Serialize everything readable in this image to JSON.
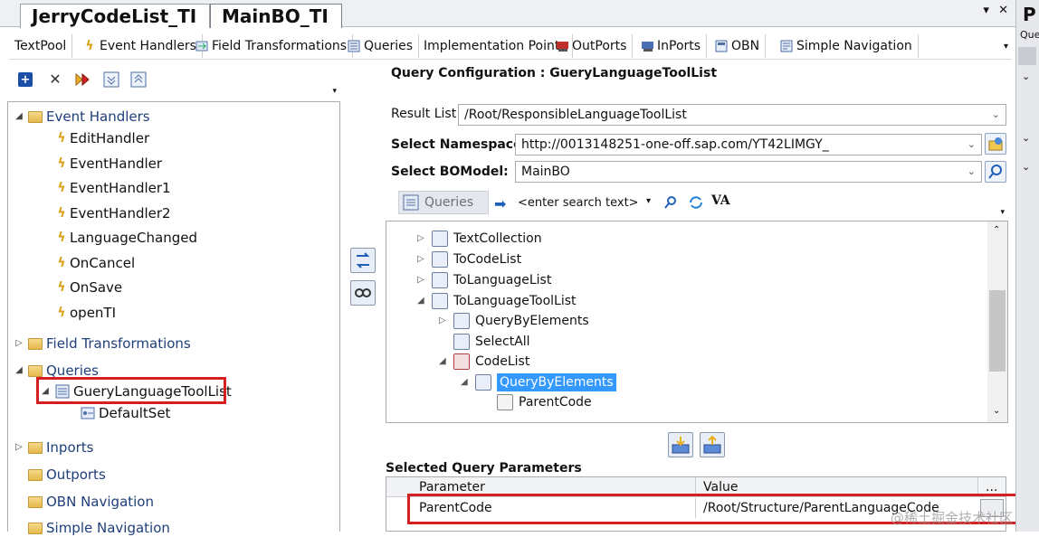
{
  "document_tabs": [
    {
      "label": "JerryCodeList_TI",
      "active": false
    },
    {
      "label": "MainBO_TI",
      "active": true
    }
  ],
  "window_controls": {
    "dropdown": "▾",
    "close": "✕"
  },
  "editor_tabs": [
    {
      "label": "TextPool",
      "icon": "none"
    },
    {
      "label": "Event Handlers",
      "icon": "lightning-icon"
    },
    {
      "label": "Field Transformations",
      "icon": "transform-icon"
    },
    {
      "label": "Queries",
      "icon": "query-icon"
    },
    {
      "label": "Implementation Points",
      "icon": "none"
    },
    {
      "label": "OutPorts",
      "icon": "outport-icon"
    },
    {
      "label": "InPorts",
      "icon": "inport-icon"
    },
    {
      "label": "OBN",
      "icon": "obn-icon"
    },
    {
      "label": "Simple Navigation",
      "icon": "navigation-icon"
    }
  ],
  "left_tree": {
    "nodes": [
      {
        "label": "Event Handlers",
        "type": "folder",
        "expanded": true
      },
      {
        "label": "EditHandler",
        "type": "handler"
      },
      {
        "label": "EventHandler",
        "type": "handler"
      },
      {
        "label": "EventHandler1",
        "type": "handler"
      },
      {
        "label": "EventHandler2",
        "type": "handler"
      },
      {
        "label": "LanguageChanged",
        "type": "handler"
      },
      {
        "label": "OnCancel",
        "type": "handler"
      },
      {
        "label": "OnSave",
        "type": "handler"
      },
      {
        "label": "openTI",
        "type": "handler"
      },
      {
        "label": "Field Transformations",
        "type": "folder",
        "expanded": false
      },
      {
        "label": "Queries",
        "type": "folder",
        "expanded": true
      },
      {
        "label": "GueryLanguageToolList",
        "type": "query",
        "selected": true
      },
      {
        "label": "DefaultSet",
        "type": "set"
      },
      {
        "label": "Inports",
        "type": "folder",
        "expanded": false
      },
      {
        "label": "Outports",
        "type": "folder"
      },
      {
        "label": "OBN Navigation",
        "type": "folder"
      },
      {
        "label": "Simple Navigation",
        "type": "folder"
      }
    ]
  },
  "query_config": {
    "title": "Query Configuration : GueryLanguageToolList",
    "result_list_label": "Result List",
    "result_list_value": "/Root/ResponsibleLanguageToolList",
    "namespace_label": "Select Namespace:",
    "namespace_value": "http://0013148251-one-off.sap.com/YT42LIMGY_",
    "bomodel_label": "Select BOModel:",
    "bomodel_value": "MainBO",
    "search_tab": "Queries",
    "search_placeholder": "<enter search text>",
    "va_label": "VA"
  },
  "query_tree": [
    {
      "label": "TextCollection",
      "expander": "▷",
      "indent": 0
    },
    {
      "label": "ToCodeList",
      "expander": "▷",
      "indent": 0
    },
    {
      "label": "ToLanguageList",
      "expander": "▷",
      "indent": 0
    },
    {
      "label": "ToLanguageToolList",
      "expander": "◢",
      "indent": 0
    },
    {
      "label": "QueryByElements",
      "expander": "▷",
      "indent": 1
    },
    {
      "label": "SelectAll",
      "expander": "",
      "indent": 1
    },
    {
      "label": "CodeList",
      "expander": "◢",
      "indent": 1
    },
    {
      "label": "QueryByElements",
      "expander": "◢",
      "indent": 2,
      "selected": true
    },
    {
      "label": "ParentCode",
      "expander": "",
      "indent": 3
    }
  ],
  "params": {
    "section_title": "Selected Query Parameters",
    "col_parameter": "Parameter",
    "col_value": "Value",
    "col_more": "...",
    "row_parameter": "ParentCode",
    "row_value": "/Root/Structure/ParentLanguageCode"
  },
  "right_edge": {
    "letter": "P",
    "label": "Que"
  },
  "watermark": "@稀土掘金技术社区",
  "colors": {
    "selection": "#3399ff",
    "highlight": "#d42020",
    "accent": "#1f5fb8"
  }
}
